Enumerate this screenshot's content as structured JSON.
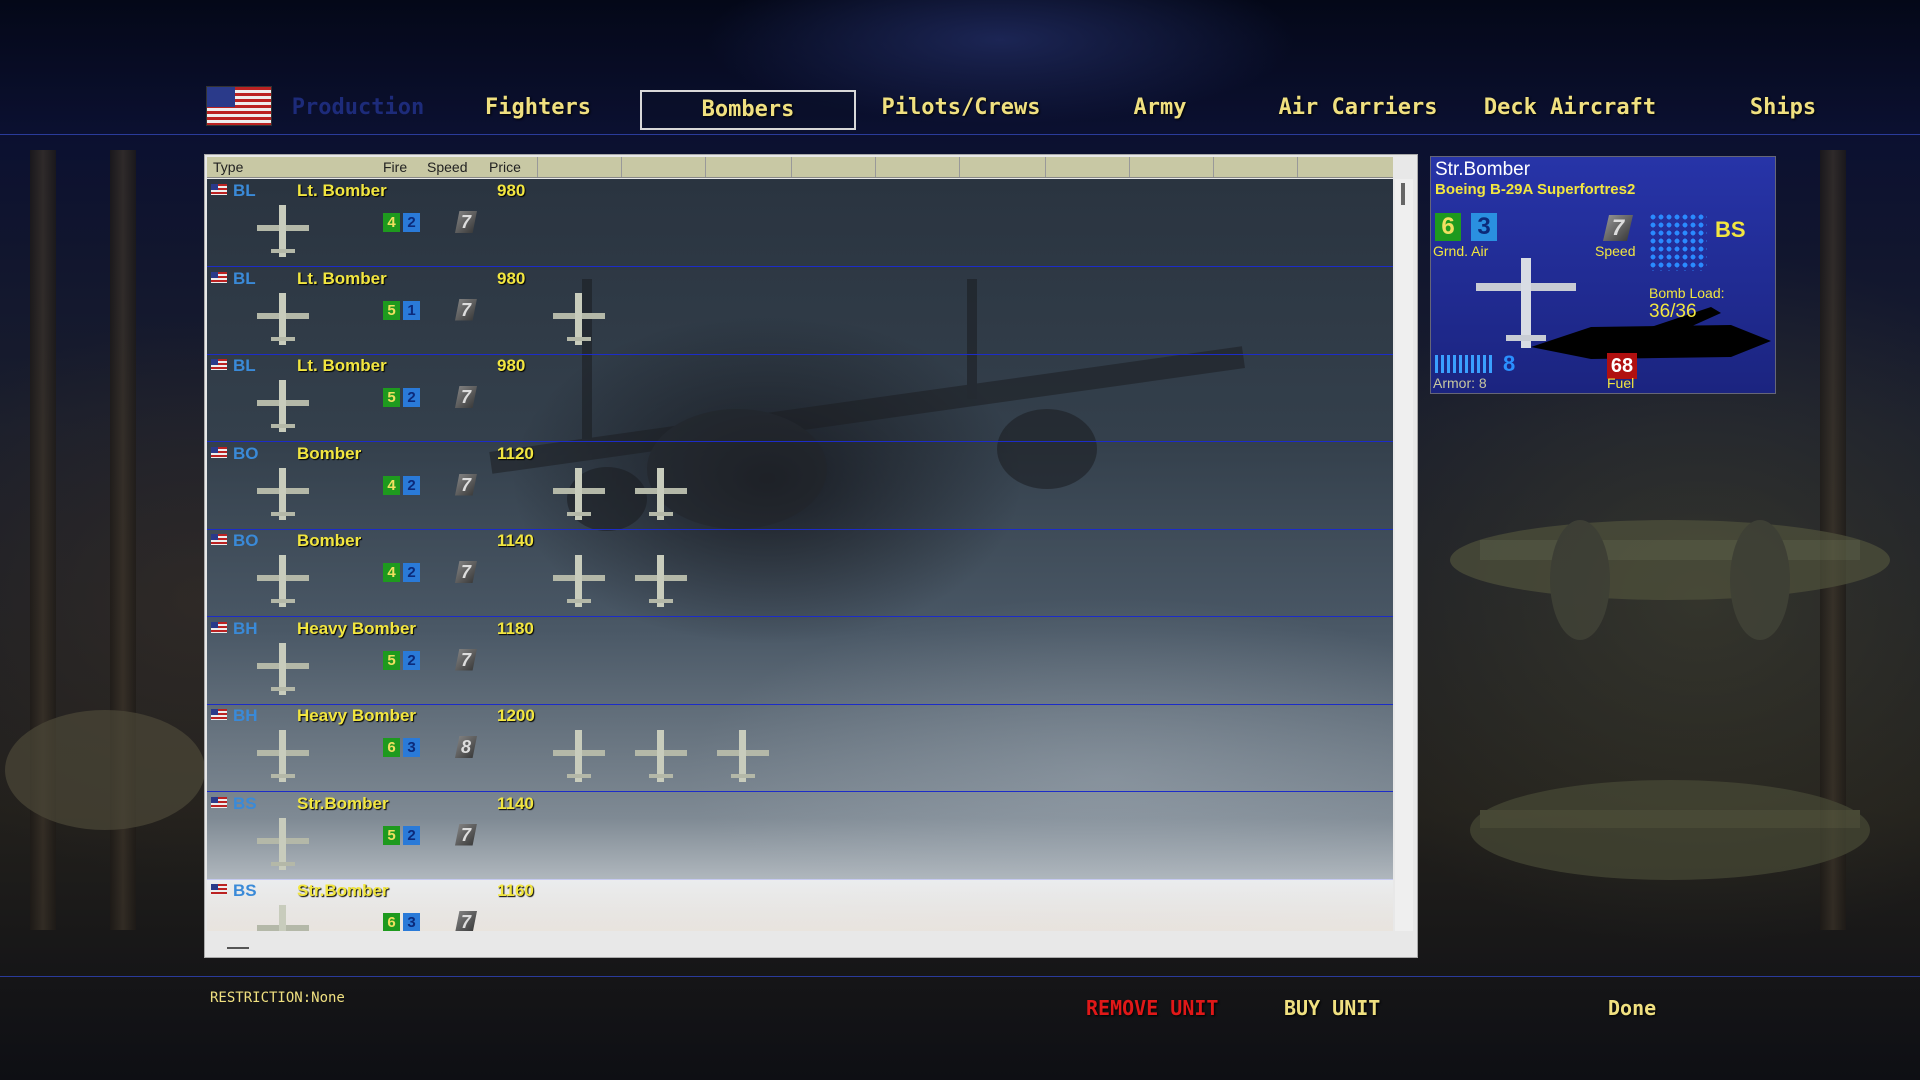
{
  "nav": {
    "production": "Production",
    "fighters": "Fighters",
    "bombers": "Bombers",
    "pilots": "Pilots/Crews",
    "army": "Army",
    "carriers": "Air Carriers",
    "deck": "Deck Aircraft",
    "ships": "Ships"
  },
  "list": {
    "headers": {
      "type": "Type",
      "fire": "Fire",
      "speed": "Speed",
      "price": "Price"
    },
    "rows": [
      {
        "code": "BL",
        "type": "Lt. Bomber",
        "price": "980",
        "fire": "4",
        "air": "2",
        "speed": "7",
        "extra": 0
      },
      {
        "code": "BL",
        "type": "Lt. Bomber",
        "price": "980",
        "fire": "5",
        "air": "1",
        "speed": "7",
        "extra": 1
      },
      {
        "code": "BL",
        "type": "Lt. Bomber",
        "price": "980",
        "fire": "5",
        "air": "2",
        "speed": "7",
        "extra": 0
      },
      {
        "code": "BO",
        "type": "Bomber",
        "price": "1120",
        "fire": "4",
        "air": "2",
        "speed": "7",
        "extra": 2
      },
      {
        "code": "BO",
        "type": "Bomber",
        "price": "1140",
        "fire": "4",
        "air": "2",
        "speed": "7",
        "extra": 2
      },
      {
        "code": "BH",
        "type": "Heavy Bomber",
        "price": "1180",
        "fire": "5",
        "air": "2",
        "speed": "7",
        "extra": 0
      },
      {
        "code": "BH",
        "type": "Heavy Bomber",
        "price": "1200",
        "fire": "6",
        "air": "3",
        "speed": "8",
        "extra": 3
      },
      {
        "code": "BS",
        "type": "Str.Bomber",
        "price": "1140",
        "fire": "5",
        "air": "2",
        "speed": "7",
        "extra": 0
      },
      {
        "code": "BS",
        "type": "Str.Bomber",
        "price": "1160",
        "fire": "6",
        "air": "3",
        "speed": "7",
        "extra": 0,
        "selected": true
      }
    ]
  },
  "detail": {
    "type": "Str.Bomber",
    "name": "Boeing B-29A Superfortres2",
    "grnd": "6",
    "air": "3",
    "grnd_air_label": "Grnd. Air",
    "speed": "7",
    "speed_label": "Speed",
    "class": "BS",
    "bomb_load_label": "Bomb Load:",
    "bomb_load": "36/36",
    "armor": "8",
    "armor_label": "Armor: 8",
    "fuel": "68",
    "fuel_label": "Fuel"
  },
  "bottom": {
    "restriction": "RESTRICTION:None",
    "remove": "REMOVE UNIT",
    "buy": "BUY UNIT",
    "done": "Done"
  },
  "colors": {
    "accent_yellow": "#f2e640",
    "remove_red": "#e01818",
    "grid_blue": "#1c2cc8"
  }
}
